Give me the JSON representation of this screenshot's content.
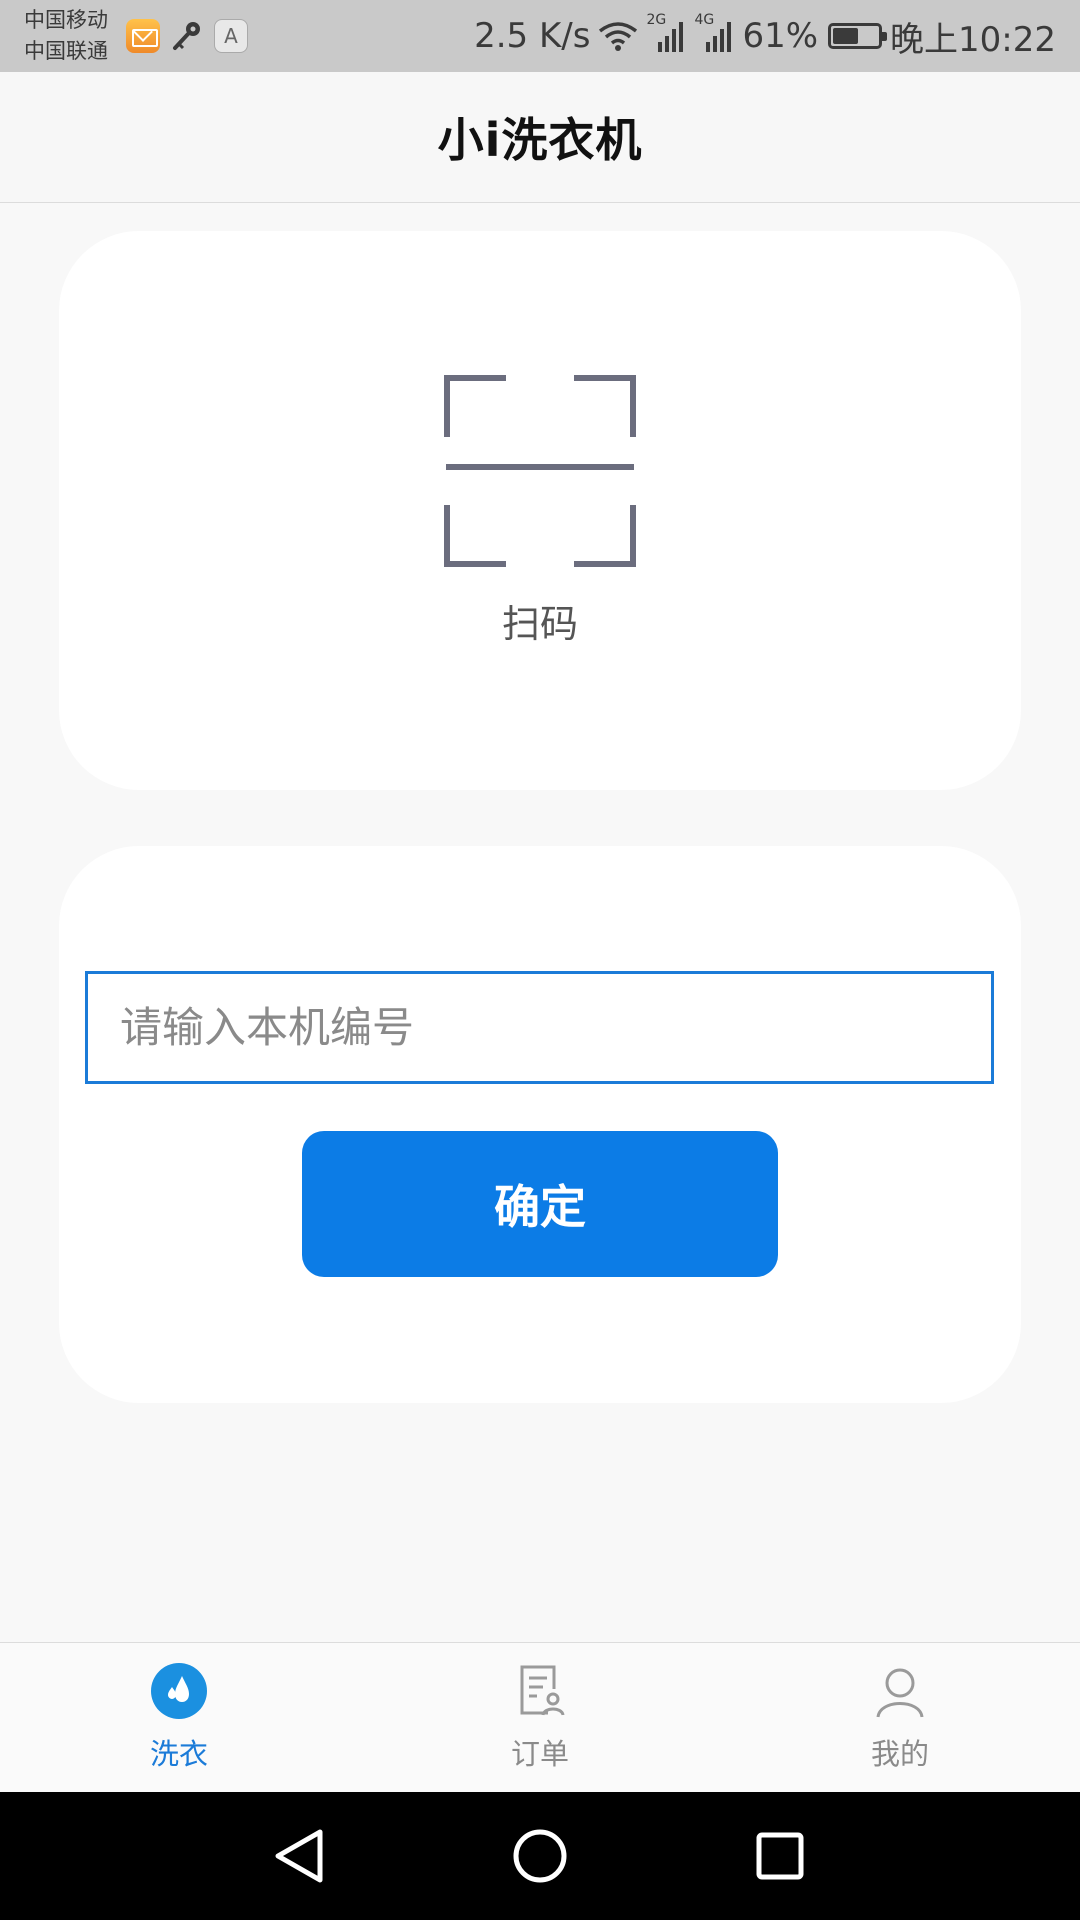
{
  "status_bar": {
    "carrier_1": "中国移动",
    "carrier_2": "中国联通",
    "a_badge": "A",
    "net_speed": "2.5 K/s",
    "network_2g": "2G",
    "network_4g": "4G",
    "battery_text": "61%",
    "battery_level": 0.61,
    "time": "晚上10:22",
    "icons": [
      "mail-icon",
      "key-icon",
      "a-icon",
      "wifi-icon",
      "signal-icon",
      "battery-icon"
    ]
  },
  "header": {
    "title": "小i洗衣机"
  },
  "scan": {
    "icon": "scan-icon",
    "label": "扫码"
  },
  "machine_input": {
    "value": "",
    "placeholder": "请输入本机编号"
  },
  "confirm": {
    "label": "确定"
  },
  "tabs": [
    {
      "label": "洗衣",
      "icon": "water-drop-icon",
      "active": true
    },
    {
      "label": "订单",
      "icon": "order-document-icon",
      "active": false
    },
    {
      "label": "我的",
      "icon": "user-icon",
      "active": false
    }
  ],
  "colors": {
    "accent": "#0c7ce6",
    "active_tab": "#1b7bd8",
    "inactive_tab": "#8a8a8a",
    "background": "#f8f8f8",
    "card": "#ffffff",
    "status_bar": "#c9c9c9"
  }
}
